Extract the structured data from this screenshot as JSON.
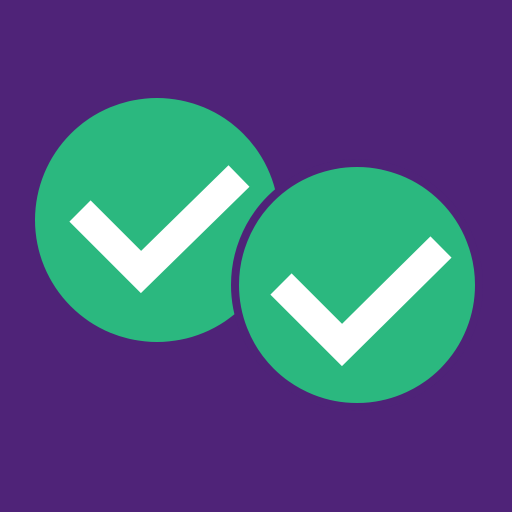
{
  "app_icon": {
    "icon_name": "double-checkmark-icon",
    "background_color": "#4f2378",
    "circle_color": "#2bb87f",
    "check_color": "#ffffff",
    "badges": [
      {
        "icon_name": "checkmark-icon"
      },
      {
        "icon_name": "checkmark-icon"
      }
    ]
  }
}
